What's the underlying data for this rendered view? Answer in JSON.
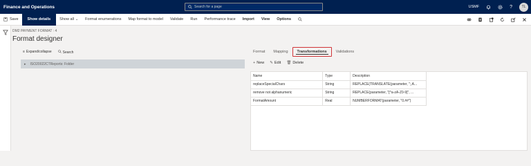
{
  "topbar": {
    "app_title": "Finance and Operations",
    "search_placeholder": "Search for a page",
    "company": "USMF",
    "notification_count": "0",
    "avatar_initials": "TL"
  },
  "actionbar": {
    "save": "Save",
    "show_details": "Show details",
    "show_all": "Show all",
    "format_enumerations": "Format enumerations",
    "map_format_to_model": "Map format to model",
    "validate": "Validate",
    "run": "Run",
    "performance_trace": "Performance trace",
    "import": "Import",
    "view": "View",
    "options": "Options"
  },
  "page": {
    "breadcrumb": "DM2 PAYMENT FORMAT : 4",
    "title": "Format designer"
  },
  "tree": {
    "expand_collapse": "Expand/collapse",
    "search": "Search",
    "root_label": "ISO20022CTReports: Folder"
  },
  "tabs": [
    "Format",
    "Mapping",
    "Transformations",
    "Validations"
  ],
  "detail_toolbar": {
    "new": "New",
    "edit": "Edit",
    "delete": "Delete"
  },
  "grid": {
    "headers": [
      "Name",
      "Type",
      "Description"
    ],
    "rows": [
      [
        "replaceSpecialChars",
        "String",
        "REPLACE(TRANSLATE(parameter, \";,A..."
      ],
      [
        "remove not alphanumeric",
        "String",
        "REPLACE(parameter, \"[^a-zA-Z0-9]\", ..."
      ],
      [
        "FormatAmount",
        "Real",
        "NUMBERFORMAT(parameter, \"0.##\")"
      ]
    ]
  },
  "colors": {
    "nav_bg": "#002050",
    "active_tab_outline": "#d13438",
    "tree_selected_bg": "#cfd4d8"
  }
}
